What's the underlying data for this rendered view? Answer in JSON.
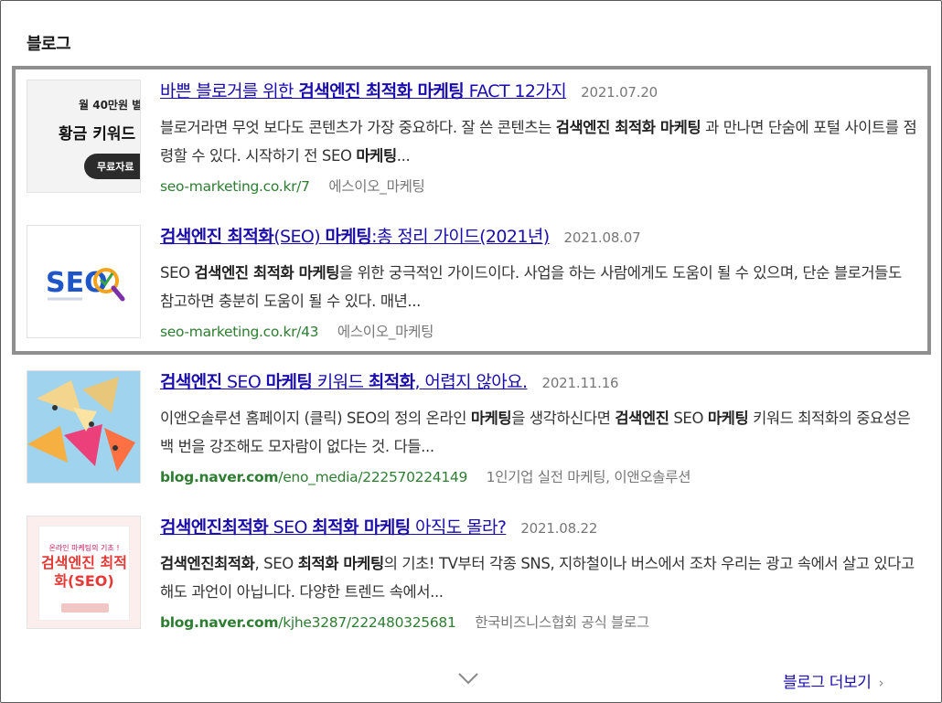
{
  "section": {
    "title": "블로그"
  },
  "results": [
    {
      "title_pre": "바쁜 블로거를 위한 ",
      "title_bold": "검색엔진 최적화 마케팅",
      "title_post": " FACT 12가지",
      "date": "2021.07.20",
      "snippet_html": "블로거라면 무엇 보다도 콘텐츠가 가장 중요하다. 잘 쓴 콘텐츠는 <b>검색엔진 최적화 마케팅</b> 과 만나면 단숨에 포털 사이트를 점령할 수 있다. 시작하기 전 SEO <b>마케팅</b>...",
      "url_host": "seo-marketing.co.kr",
      "url_path": "/7",
      "url_host_bold": false,
      "author": "에스이오_마케팅",
      "thumb": {
        "line1": "월 40만원 별",
        "line2": "황금 키워드",
        "button": "무료자료"
      }
    },
    {
      "title_pre": "",
      "title_bold": "검색엔진 최적화",
      "title_post": "(SEO) <b>마케팅</b>:총 정리 가이드(2021년)",
      "date": "2021.08.07",
      "snippet_html": "SEO <b>검색엔진 최적화 마케팅</b>을 위한 궁극적인 가이드이다. 사업을 하는 사람에게도 도움이 될 수 있으며, 단순 블로거들도 참고하면 충분히 도움이 될 수 있다. 매년...",
      "url_host": "seo-marketing.co.kr",
      "url_path": "/43",
      "url_host_bold": false,
      "author": "에스이오_마케팅",
      "thumb": {
        "logo": "SEO"
      }
    },
    {
      "title_pre": "",
      "title_bold": "검색엔진",
      "title_post": " SEO <b>마케팅</b> 키워드 <b>최적화</b>, 어렵지 않아요.",
      "date": "2021.11.16",
      "snippet_html": "이앤오솔루션 홈페이지 (클릭) SEO의 정의 온라인 <b>마케팅</b>을 생각하신다면 <b>검색엔진</b> SEO <b>마케팅</b> 키워드 최적화의 중요성은 백 번을 강조해도 모자람이 없다는 것. 다들...",
      "url_host": "blog.naver.com",
      "url_path": "/eno_media/222570224149",
      "url_host_bold": true,
      "author": "1인기업 실전 마케팅, 이앤오솔루션",
      "thumb": {}
    },
    {
      "title_pre": "",
      "title_bold": "검색엔진최적화",
      "title_post": " SEO <b>최적화 마케팅</b> 아직도 몰라?",
      "date": "2021.08.22",
      "snippet_html": "<b>검색엔진최적화</b>, SEO <b>최적화 마케팅</b>의 기초! TV부터 각종 SNS, 지하철이나 버스에서 조차 우리는 광고 속에서 살고 있다고 해도 과언이 아닙니다. 다양한 트렌드 속에서...",
      "url_host": "blog.naver.com",
      "url_path": "/kjhe3287/222480325681",
      "url_host_bold": true,
      "author": "한국비즈니스협회 공식 블로그",
      "thumb": {
        "line1": "온라인 마케팅의 기초 !",
        "line2": "검색엔진 최적화(SEO)"
      }
    }
  ],
  "footer": {
    "more_label": "블로그 더보기",
    "more_arrow": "›",
    "expand_icon": "chevron-down-icon"
  },
  "colors": {
    "link": "#1a0dab",
    "url": "#2e7d32",
    "meta": "#777777",
    "highlight_border": "#8f8f8f"
  }
}
